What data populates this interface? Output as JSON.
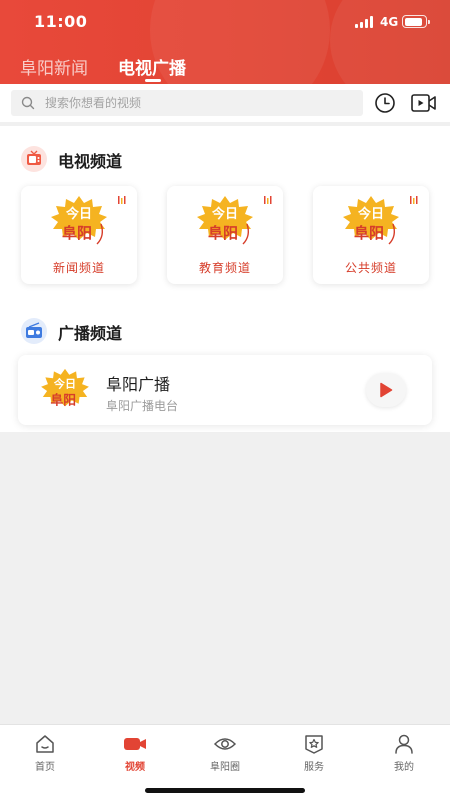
{
  "status_bar": {
    "time": "11:00",
    "network": "4G"
  },
  "top_tabs": [
    {
      "label": "阜阳新闻",
      "active": false
    },
    {
      "label": "电视广播",
      "active": true
    }
  ],
  "search": {
    "placeholder": "搜索你想看的视频"
  },
  "tv_section": {
    "title": "电视频道",
    "channels": [
      {
        "name": "新闻频道"
      },
      {
        "name": "教育频道"
      },
      {
        "name": "公共频道"
      }
    ]
  },
  "logo_text": {
    "line1": "今日",
    "line2": "阜阳"
  },
  "radio_section": {
    "title": "广播频道",
    "station": {
      "name": "阜阳广播",
      "subtitle": "阜阳广播电台"
    }
  },
  "bottom_nav": [
    {
      "label": "首页",
      "icon": "home-icon",
      "active": false
    },
    {
      "label": "视频",
      "icon": "video-camera-icon",
      "active": true
    },
    {
      "label": "阜阳圈",
      "icon": "eye-icon",
      "active": false
    },
    {
      "label": "服务",
      "icon": "service-star-icon",
      "active": false
    },
    {
      "label": "我的",
      "icon": "person-icon",
      "active": false
    }
  ],
  "colors": {
    "brand_red": "#e24434",
    "background": "#f0f0f0",
    "logo_gold": "#f5b321"
  }
}
